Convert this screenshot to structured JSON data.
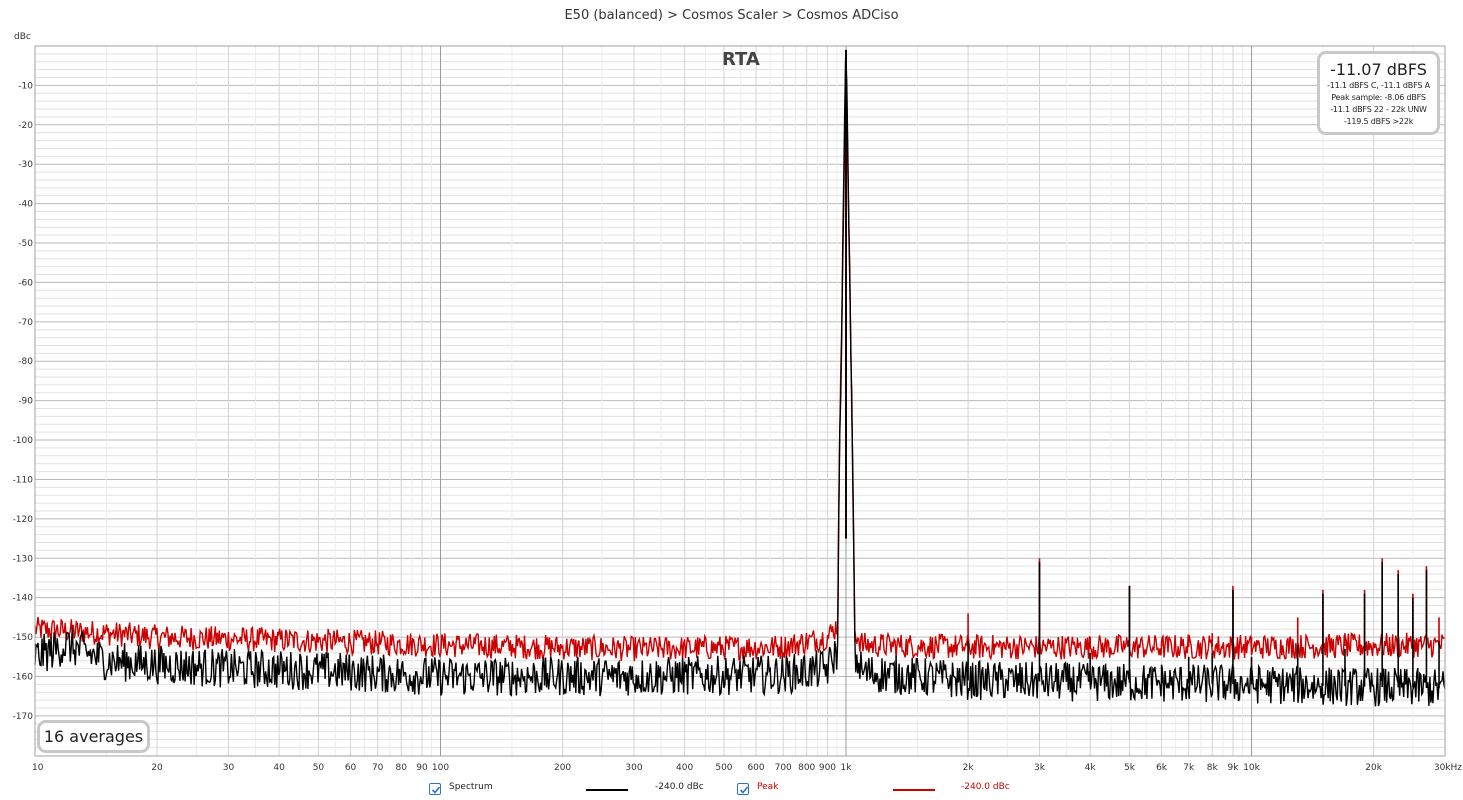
{
  "title": "E50 (balanced) > Cosmos Scaler > Cosmos ADCiso",
  "plot_label": "RTA",
  "y_unit": "dBc",
  "stats": {
    "main": "-11.07 dBFS",
    "lines": [
      "-11.1 dBFS C, -11.1 dBFS A",
      "Peak sample: -8.06 dBFS",
      "-11.1 dBFS 22 - 22k UNW",
      "-119.5 dBFS >22k"
    ]
  },
  "averages_label": "16 averages",
  "legend": [
    {
      "name": "Spectrum",
      "value": "-240.0 dBc",
      "color": "#000000",
      "checked": true
    },
    {
      "name": "Peak",
      "value": "-240.0 dBc",
      "color": "#cc0000",
      "checked": true
    }
  ],
  "colors": {
    "spectrum": "#000000",
    "peak": "#cc0000",
    "grid_major": "#a0a0a0",
    "grid_minor": "#dcdcdc",
    "checkbox": "#2a73c8"
  },
  "chart_data": {
    "type": "line",
    "xlabel": "",
    "ylabel": "dBc",
    "x_scale": "log",
    "xlim": [
      10,
      30000
    ],
    "ylim": [
      -180,
      0
    ],
    "grid": true,
    "x_ticks": [
      {
        "value": 10,
        "label": "10"
      },
      {
        "value": 20,
        "label": "20"
      },
      {
        "value": 30,
        "label": "30"
      },
      {
        "value": 40,
        "label": "40"
      },
      {
        "value": 50,
        "label": "50"
      },
      {
        "value": 60,
        "label": "60"
      },
      {
        "value": 70,
        "label": "70"
      },
      {
        "value": 80,
        "label": "80"
      },
      {
        "value": 90,
        "label": "90"
      },
      {
        "value": 100,
        "label": "100"
      },
      {
        "value": 200,
        "label": "200"
      },
      {
        "value": 300,
        "label": "300"
      },
      {
        "value": 400,
        "label": "400"
      },
      {
        "value": 500,
        "label": "500"
      },
      {
        "value": 600,
        "label": "600"
      },
      {
        "value": 700,
        "label": "700"
      },
      {
        "value": 800,
        "label": "800"
      },
      {
        "value": 900,
        "label": "900"
      },
      {
        "value": 1000,
        "label": "1k"
      },
      {
        "value": 2000,
        "label": "2k"
      },
      {
        "value": 3000,
        "label": "3k"
      },
      {
        "value": 4000,
        "label": "4k"
      },
      {
        "value": 5000,
        "label": "5k"
      },
      {
        "value": 6000,
        "label": "6k"
      },
      {
        "value": 7000,
        "label": "7k"
      },
      {
        "value": 8000,
        "label": "8k"
      },
      {
        "value": 9000,
        "label": "9k"
      },
      {
        "value": 10000,
        "label": "10k"
      },
      {
        "value": 20000,
        "label": "20k"
      },
      {
        "value": 30000,
        "label": "30kHz"
      }
    ],
    "y_ticks": [
      {
        "value": -10,
        "label": "-10"
      },
      {
        "value": -20,
        "label": "-20"
      },
      {
        "value": -30,
        "label": "-30"
      },
      {
        "value": -40,
        "label": "-40"
      },
      {
        "value": -50,
        "label": "-50"
      },
      {
        "value": -60,
        "label": "-60"
      },
      {
        "value": -70,
        "label": "-70"
      },
      {
        "value": -80,
        "label": "-80"
      },
      {
        "value": -90,
        "label": "-90"
      },
      {
        "value": -100,
        "label": "-100"
      },
      {
        "value": -110,
        "label": "-110"
      },
      {
        "value": -120,
        "label": "-120"
      },
      {
        "value": -130,
        "label": "-130"
      },
      {
        "value": -140,
        "label": "-140"
      },
      {
        "value": -150,
        "label": "-150"
      },
      {
        "value": -160,
        "label": "-160"
      },
      {
        "value": -170,
        "label": "-170"
      }
    ],
    "series": [
      {
        "name": "Spectrum",
        "color": "#000000",
        "noise_floor": [
          [
            10,
            -155
          ],
          [
            12,
            -152
          ],
          [
            15,
            -156
          ],
          [
            20,
            -157
          ],
          [
            30,
            -158
          ],
          [
            50,
            -158.5
          ],
          [
            100,
            -160
          ],
          [
            300,
            -160
          ],
          [
            700,
            -159.5
          ],
          [
            900,
            -158
          ],
          [
            970,
            -152
          ],
          [
            1000,
            -1
          ],
          [
            1030,
            -153
          ],
          [
            1100,
            -159
          ],
          [
            2000,
            -161
          ],
          [
            10000,
            -162
          ],
          [
            30000,
            -163
          ]
        ],
        "peaks": [
          [
            2000,
            -151
          ],
          [
            3000,
            -131
          ],
          [
            4000,
            -154
          ],
          [
            5000,
            -137
          ],
          [
            6000,
            -157
          ],
          [
            7000,
            -155
          ],
          [
            8000,
            -154
          ],
          [
            9000,
            -138
          ],
          [
            10000,
            -155
          ],
          [
            13000,
            -152
          ],
          [
            15000,
            -139
          ],
          [
            17000,
            -153
          ],
          [
            19000,
            -139
          ],
          [
            21000,
            -131
          ],
          [
            23000,
            -134
          ],
          [
            25000,
            -140
          ],
          [
            27000,
            -133
          ],
          [
            29000,
            -151
          ]
        ]
      },
      {
        "name": "Peak",
        "color": "#cc0000",
        "noise_floor": [
          [
            10,
            -148
          ],
          [
            15,
            -149
          ],
          [
            20,
            -150
          ],
          [
            50,
            -151
          ],
          [
            100,
            -152
          ],
          [
            300,
            -153
          ],
          [
            700,
            -152.5
          ],
          [
            900,
            -150
          ],
          [
            970,
            -146
          ],
          [
            1000,
            -1
          ],
          [
            1030,
            -147
          ],
          [
            1100,
            -152
          ],
          [
            2000,
            -152.5
          ],
          [
            10000,
            -152.5
          ],
          [
            30000,
            -152
          ]
        ],
        "peaks": [
          [
            2000,
            -144
          ],
          [
            3000,
            -130
          ],
          [
            4000,
            -150
          ],
          [
            5000,
            -137
          ],
          [
            6000,
            -151
          ],
          [
            7000,
            -150
          ],
          [
            8000,
            -149
          ],
          [
            9000,
            -137
          ],
          [
            10000,
            -150
          ],
          [
            13000,
            -145
          ],
          [
            15000,
            -138
          ],
          [
            17000,
            -149
          ],
          [
            19000,
            -138
          ],
          [
            21000,
            -130
          ],
          [
            23000,
            -133
          ],
          [
            25000,
            -139
          ],
          [
            27000,
            -132
          ],
          [
            29000,
            -145
          ]
        ]
      }
    ]
  }
}
